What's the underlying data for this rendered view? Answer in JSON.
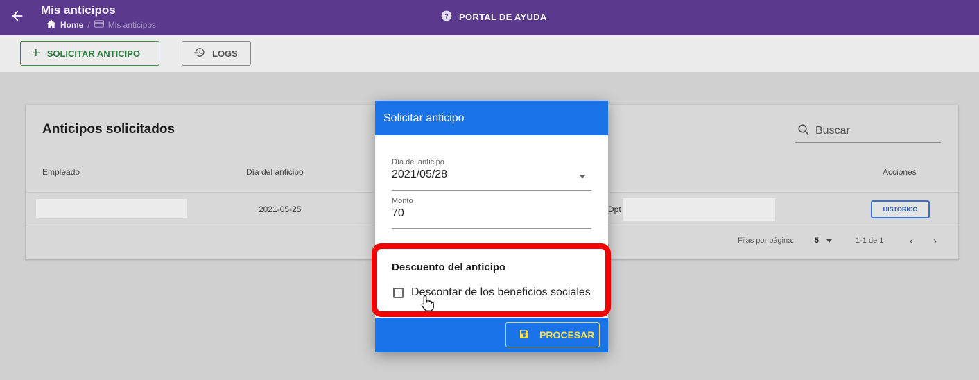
{
  "header": {
    "title": "Mis anticipos",
    "breadcrumb_home": "Home",
    "breadcrumb_sep": "/",
    "breadcrumb_current": "Mis anticipos",
    "help_label": "PORTAL DE AYUDA"
  },
  "toolbar": {
    "solicitar_label": "SOLICITAR ANTICIPO",
    "logs_label": "LOGS"
  },
  "card": {
    "title": "Anticipos solicitados",
    "search_placeholder": "Buscar",
    "columns": [
      "Empleado",
      "Día del anticipo",
      "Acciones"
    ],
    "row": {
      "date": "2021-05-25",
      "dept_prefix": "Dpt",
      "action_label": "HISTORICO"
    },
    "footer": {
      "rows_per_page_label": "Filas por página:",
      "rows_per_page_value": "5",
      "range": "1-1 de 1"
    }
  },
  "modal": {
    "title": "Solicitar anticipo",
    "date_label": "Día del anticipo",
    "date_value": "2021/05/28",
    "amount_label": "Monto",
    "amount_value": "70",
    "section_title": "Descuento del anticipo",
    "checkbox_label": "Descontar de los beneficios sociales",
    "process_label": "PROCESAR"
  },
  "colors": {
    "topbar": "#5b3a8e",
    "modal_primary": "#1a73e8",
    "highlight": "#f40000",
    "process_text": "#f9e04a"
  }
}
